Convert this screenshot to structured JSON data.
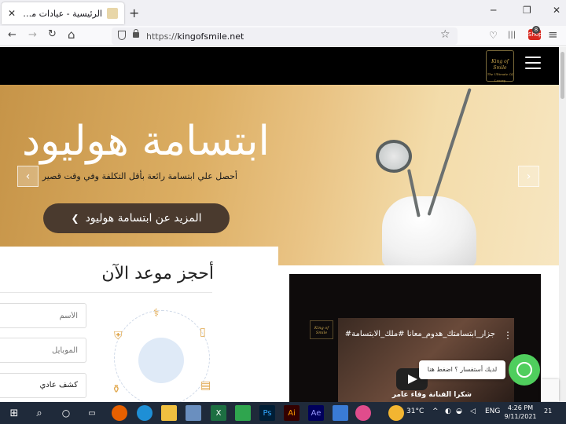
{
  "browser": {
    "tab_title": "الرئيسية - عيادات ملك الأبتسامة",
    "tab_close": "✕",
    "new_tab": "+",
    "url_scheme": "https://",
    "url_domain": "kingofsmile.net",
    "badge_count": "8",
    "badge_label": "Shop",
    "window_min": "─",
    "window_max": "❐",
    "window_close": "✕",
    "icons": {
      "back": "back-arrow-icon",
      "forward": "forward-arrow-icon",
      "reload": "reload-icon",
      "home": "home-icon",
      "bookmark": "star-icon",
      "pocket": "pocket-icon",
      "library": "library-icon",
      "menu": "hamburger-menu-icon"
    },
    "glyphs": {
      "back": "←",
      "forward": "→",
      "reload": "↻",
      "home": "⌂",
      "star": "☆",
      "pocket": "♡",
      "library": "|||",
      "menu": "≡"
    }
  },
  "site": {
    "logo_text": "King of Smile",
    "logo_sub": "The Ultimate Of Luxury",
    "hero": {
      "title": "ابتسامة هوليود",
      "subtitle": "أحصل علي ابتسامة رائعة بأقل التكلفة وفي وقت قصير",
      "button": "المزيد عن ابتسامة هوليود",
      "button_chevron": "❯",
      "prev": "‹",
      "next": "›"
    },
    "booking": {
      "title": "أحجز موعد الآن",
      "name_placeholder": "الأسم",
      "mobile_placeholder": "الموبايل",
      "type_value": "كشف عادي"
    },
    "video": {
      "title": "جزار_ابتسامتك_هدوم_معانا #ملك_الابتسامة#",
      "caption": "شكرا الفنانة وفاء عامر",
      "menu": "⋮"
    },
    "whatsapp": {
      "bubble": "لديك أستفسار ؟ اضغط هنا"
    }
  },
  "taskbar": {
    "weather": "31°C",
    "language": "ENG",
    "time": "4:26 PM",
    "date": "9/11/2021",
    "notification_count": "21",
    "app_labels": [
      "X",
      "Ps",
      "Ai",
      "Ae"
    ],
    "search_glyph": "⌕",
    "caret": "^"
  },
  "colors": {
    "hero_gold": "#d9a95c",
    "button_brown": "#4a3a2e",
    "whatsapp_green": "#4fce5d",
    "taskbar": "#1f2a3a"
  }
}
